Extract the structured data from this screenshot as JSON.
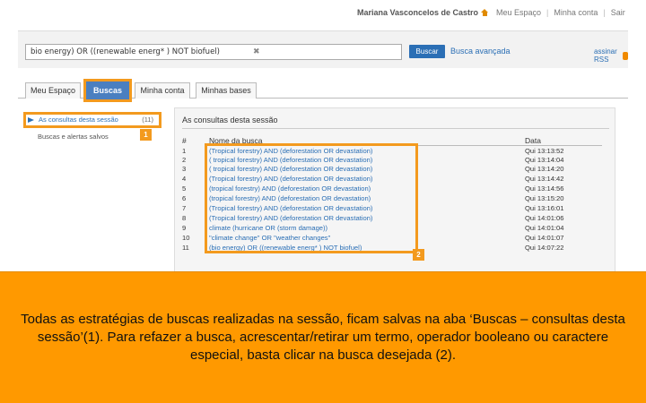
{
  "top_bar": {
    "user_name": "Mariana Vasconcelos de Castro",
    "links": [
      "Meu Espaço",
      "Minha conta",
      "Sair"
    ]
  },
  "search": {
    "query_value": "bio energy) OR ((renewable energ* ) NOT biofuel)",
    "clear_symbol": "✖",
    "search_button": "Buscar",
    "advanced_link": "Busca avançada",
    "rss_label": "assinar RSS"
  },
  "tabs": [
    {
      "label": "Meu Espaço",
      "active": false
    },
    {
      "label": "Buscas",
      "active": true
    },
    {
      "label": "Minha conta",
      "active": false
    },
    {
      "label": "Minhas bases",
      "active": false
    }
  ],
  "sidebar": {
    "items": [
      {
        "label": "As consultas desta sessão",
        "count": "(11)"
      },
      {
        "label": "Buscas e alertas salvos"
      }
    ]
  },
  "badges": {
    "one": "1",
    "two": "2"
  },
  "results": {
    "title": "As consultas desta sessão",
    "columns": {
      "num": "#",
      "query": "Nome da busca",
      "date": "Data"
    },
    "rows": [
      {
        "num": "1",
        "query": "(Tropical forestry) AND (deforestation OR devastation)",
        "date": "Qui 13:13:52"
      },
      {
        "num": "2",
        "query": "( tropical forestry) AND (deforestation OR devastation)",
        "date": "Qui 13:14:04"
      },
      {
        "num": "3",
        "query": "( tropical forestry) AND (deforestation OR devastation)",
        "date": "Qui 13:14:20"
      },
      {
        "num": "4",
        "query": "(Tropical forestry) AND (deforestation OR devastation)",
        "date": "Qui 13:14:42"
      },
      {
        "num": "5",
        "query": "(tropical forestry) AND (deforestation OR devastation)",
        "date": "Qui 13:14:56"
      },
      {
        "num": "6",
        "query": "(tropical forestry) AND (deforestation OR devastation)",
        "date": "Qui 13:15:20"
      },
      {
        "num": "7",
        "query": "(Tropical forestry) AND (deforestation OR devastation)",
        "date": "Qui 13:16:01"
      },
      {
        "num": "8",
        "query": "(Tropical forestry) AND (deforestation OR devastation)",
        "date": "Qui 14:01:06"
      },
      {
        "num": "9",
        "query": "climate (hurricane OR (storm damage))",
        "date": "Qui 14:01:04"
      },
      {
        "num": "10",
        "query": "\"climate change\" OR \"weather changes\"",
        "date": "Qui 14:01:07"
      },
      {
        "num": "11",
        "query": "(bio energy) OR ((renewable energ* ) NOT biofuel)",
        "date": "Qui 14:07:22"
      }
    ]
  },
  "caption": "Todas as estratégias de buscas realizadas na sessão, ficam salvas na aba ‘Buscas – consultas desta sessão’(1). Para refazer a busca, acrescentar/retirar um termo, operador booleano ou caractere especial, basta clicar na busca desejada (2).",
  "colors": {
    "accent_orange": "#f39a1e",
    "caption_bg": "#ff9900",
    "link_blue": "#2b6fb5",
    "active_tab": "#4a7fc0"
  }
}
